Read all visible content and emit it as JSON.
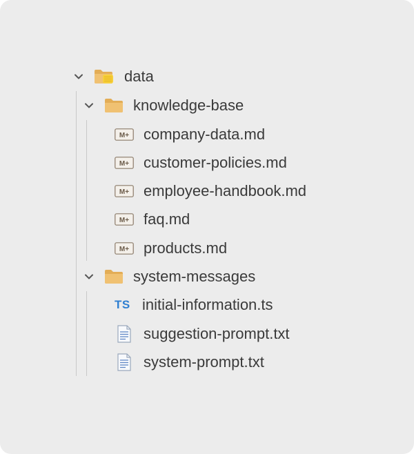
{
  "tree": {
    "root": {
      "label": "data",
      "icon": "folder-with-badge-icon",
      "expanded": true
    },
    "knowledge_base": {
      "label": "knowledge-base",
      "icon": "folder-icon",
      "expanded": true,
      "files": [
        {
          "label": "company-data.md",
          "icon": "markdown-icon",
          "icon_text": "M+"
        },
        {
          "label": "customer-policies.md",
          "icon": "markdown-icon",
          "icon_text": "M+"
        },
        {
          "label": "employee-handbook.md",
          "icon": "markdown-icon",
          "icon_text": "M+"
        },
        {
          "label": "faq.md",
          "icon": "markdown-icon",
          "icon_text": "M+"
        },
        {
          "label": "products.md",
          "icon": "markdown-icon",
          "icon_text": "M+"
        }
      ]
    },
    "system_messages": {
      "label": "system-messages",
      "icon": "folder-icon",
      "expanded": true,
      "files": [
        {
          "label": "initial-information.ts",
          "icon": "typescript-icon",
          "icon_text": "TS"
        },
        {
          "label": "suggestion-prompt.txt",
          "icon": "text-file-icon"
        },
        {
          "label": "system-prompt.txt",
          "icon": "text-file-icon"
        }
      ]
    }
  },
  "colors": {
    "background": "#ececec",
    "folder": "#e8b865",
    "typescript": "#2f7fd1",
    "text": "#3a3a3a"
  }
}
